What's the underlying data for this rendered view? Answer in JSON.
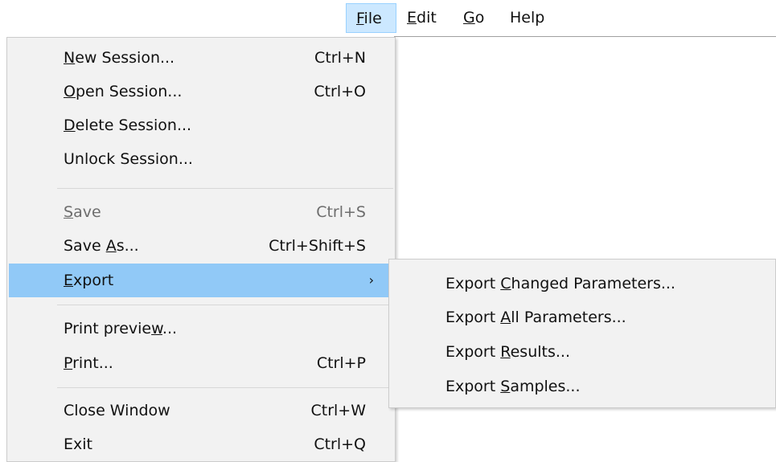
{
  "menubar": {
    "file": {
      "pre": "",
      "key": "F",
      "post": "ile"
    },
    "edit": {
      "pre": "",
      "key": "E",
      "post": "dit"
    },
    "go": {
      "pre": "",
      "key": "G",
      "post": "o"
    },
    "help": {
      "label": "Help"
    }
  },
  "file_menu": {
    "new_session": {
      "pre": "",
      "key": "N",
      "post": "ew Session...",
      "shortcut": "Ctrl+N"
    },
    "open_session": {
      "pre": "",
      "key": "O",
      "post": "pen Session...",
      "shortcut": "Ctrl+O"
    },
    "delete_session": {
      "pre": "",
      "key": "D",
      "post": "elete Session..."
    },
    "unlock_session": {
      "label": "Unlock Session..."
    },
    "save": {
      "pre": "",
      "key": "S",
      "post": "ave",
      "shortcut": "Ctrl+S"
    },
    "save_as": {
      "pre": "Save ",
      "key": "A",
      "post": "s...",
      "shortcut": "Ctrl+Shift+S"
    },
    "export": {
      "pre": "",
      "key": "E",
      "post": "xport",
      "arrow": "›"
    },
    "print_preview": {
      "pre": "Print previe",
      "key": "w",
      "post": "..."
    },
    "print": {
      "pre": "",
      "key": "P",
      "post": "rint...",
      "shortcut": "Ctrl+P"
    },
    "close_window": {
      "label": "Close Window",
      "shortcut": "Ctrl+W"
    },
    "exit": {
      "label": "Exit",
      "shortcut": "Ctrl+Q"
    }
  },
  "export_submenu": {
    "changed_params": {
      "pre": "Export ",
      "key": "C",
      "post": "hanged Parameters..."
    },
    "all_params": {
      "pre": "Export ",
      "key": "A",
      "post": "ll Parameters..."
    },
    "results": {
      "pre": "Export ",
      "key": "R",
      "post": "esults..."
    },
    "samples": {
      "pre": "Export ",
      "key": "S",
      "post": "amples..."
    }
  }
}
